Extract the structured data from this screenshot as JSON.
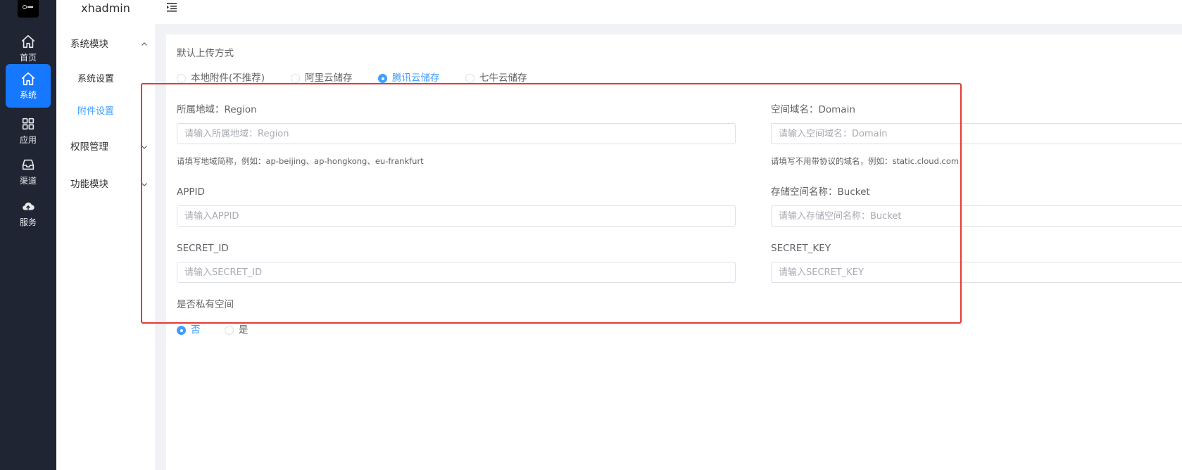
{
  "brand": {
    "name": "xhadmin"
  },
  "rail": {
    "items": [
      {
        "label": "首页",
        "icon": "home-icon"
      },
      {
        "label": "系统",
        "icon": "home-icon"
      },
      {
        "label": "应用",
        "icon": "grid-icon"
      },
      {
        "label": "渠道",
        "icon": "inbox-icon"
      },
      {
        "label": "服务",
        "icon": "cloud-upload-icon"
      }
    ],
    "active_index": 1
  },
  "submenu": {
    "groups": [
      {
        "label": "系统模块",
        "expanded": true,
        "children": [
          "系统设置",
          "附件设置"
        ]
      },
      {
        "label": "权限管理",
        "expanded": false
      },
      {
        "label": "功能模块",
        "expanded": false
      }
    ],
    "active_child": "附件设置"
  },
  "form": {
    "upload_method": {
      "label": "默认上传方式",
      "options": [
        "本地附件(不推荐)",
        "阿里云储存",
        "腾讯云储存",
        "七牛云储存"
      ],
      "selected": "腾讯云储存"
    },
    "region": {
      "label": "所属地域：Region",
      "placeholder": "请输入所属地域：Region",
      "hint": "请填写地域简称，例如：ap-beijing、ap-hongkong、eu-frankfurt"
    },
    "domain": {
      "label": "空间域名：Domain",
      "placeholder": "请输入空间域名：Domain",
      "hint": "请填写不用带协议的域名，例如：static.cloud.com"
    },
    "appid": {
      "label": "APPID",
      "placeholder": "请输入APPID"
    },
    "bucket": {
      "label": "存储空间名称：Bucket",
      "placeholder": "请输入存储空间名称：Bucket"
    },
    "secret_id": {
      "label": "SECRET_ID",
      "placeholder": "请输入SECRET_ID"
    },
    "secret_key": {
      "label": "SECRET_KEY",
      "placeholder": "请输入SECRET_KEY"
    },
    "private_space": {
      "label": "是否私有空间",
      "options": [
        "否",
        "是"
      ],
      "selected": "否"
    }
  },
  "colors": {
    "accent": "#409eff",
    "rail_bg": "#1f2532",
    "rail_active": "#1677ff",
    "highlight_border": "#e53935"
  }
}
